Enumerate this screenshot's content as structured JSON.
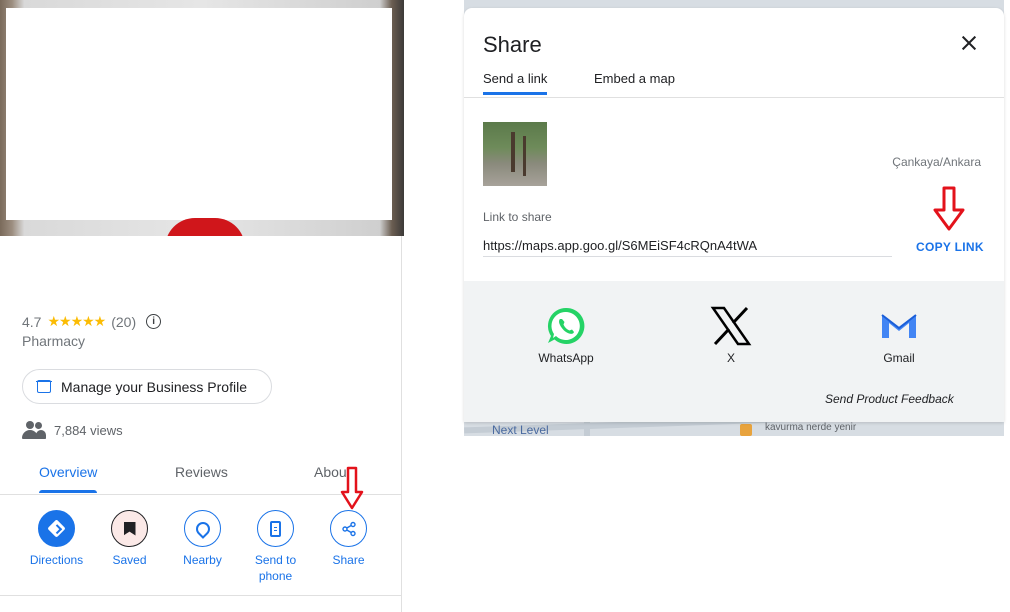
{
  "place": {
    "rating": "4.7",
    "stars": "★★★★★",
    "review_count": "(20)",
    "category": "Pharmacy",
    "manage_profile_label": "Manage your Business Profile",
    "views": "7,884 views"
  },
  "place_tabs": [
    {
      "label": "Overview",
      "active": true
    },
    {
      "label": "Reviews",
      "active": false
    },
    {
      "label": "About",
      "active": false
    }
  ],
  "actions": [
    {
      "label": "Directions",
      "icon": "directions-icon"
    },
    {
      "label": "Saved",
      "icon": "bookmark-icon"
    },
    {
      "label": "Nearby",
      "icon": "nearby-icon"
    },
    {
      "label": "Send to phone",
      "icon": "send-to-phone-icon"
    },
    {
      "label": "Share",
      "icon": "share-icon"
    }
  ],
  "share_dialog": {
    "title": "Share",
    "tabs": [
      {
        "label": "Send a link",
        "active": true
      },
      {
        "label": "Embed a map",
        "active": false
      }
    ],
    "address": "Çankaya/Ankara",
    "link_label": "Link to share",
    "link_value": "https://maps.app.goo.gl/S6MEiSF4cRQnA4tWA",
    "copy_link_label": "COPY LINK",
    "share_targets": [
      {
        "label": "WhatsApp",
        "icon": "whatsapp-icon"
      },
      {
        "label": "X",
        "icon": "x-logo-icon"
      },
      {
        "label": "Gmail",
        "icon": "gmail-icon"
      }
    ],
    "feedback_label": "Send Product Feedback"
  },
  "map_background": {
    "label_1": "Next Level",
    "label_2": "kavurma nerde yenir"
  },
  "colors": {
    "accent": "#1a73e8",
    "annotation_arrow": "#e3121b",
    "whatsapp": "#25d366",
    "star": "#fbbc04"
  }
}
